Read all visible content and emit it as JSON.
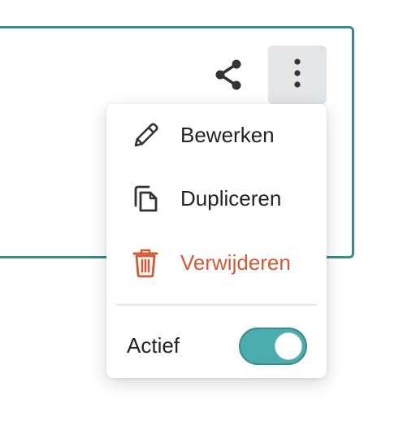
{
  "toolbar": {
    "share_icon": "share-icon",
    "more_icon": "vertical-ellipsis-icon"
  },
  "menu": {
    "items": [
      {
        "label": "Bewerken",
        "icon": "pencil-icon"
      },
      {
        "label": "Dupliceren",
        "icon": "copy-icon"
      },
      {
        "label": "Verwijderen",
        "icon": "trash-icon",
        "color": "#cf5a33"
      }
    ],
    "active": {
      "label": "Actief",
      "on": true
    }
  },
  "colors": {
    "accent": "#3b8a8e",
    "toggle_on": "#4aacac",
    "danger": "#cf5a33"
  }
}
